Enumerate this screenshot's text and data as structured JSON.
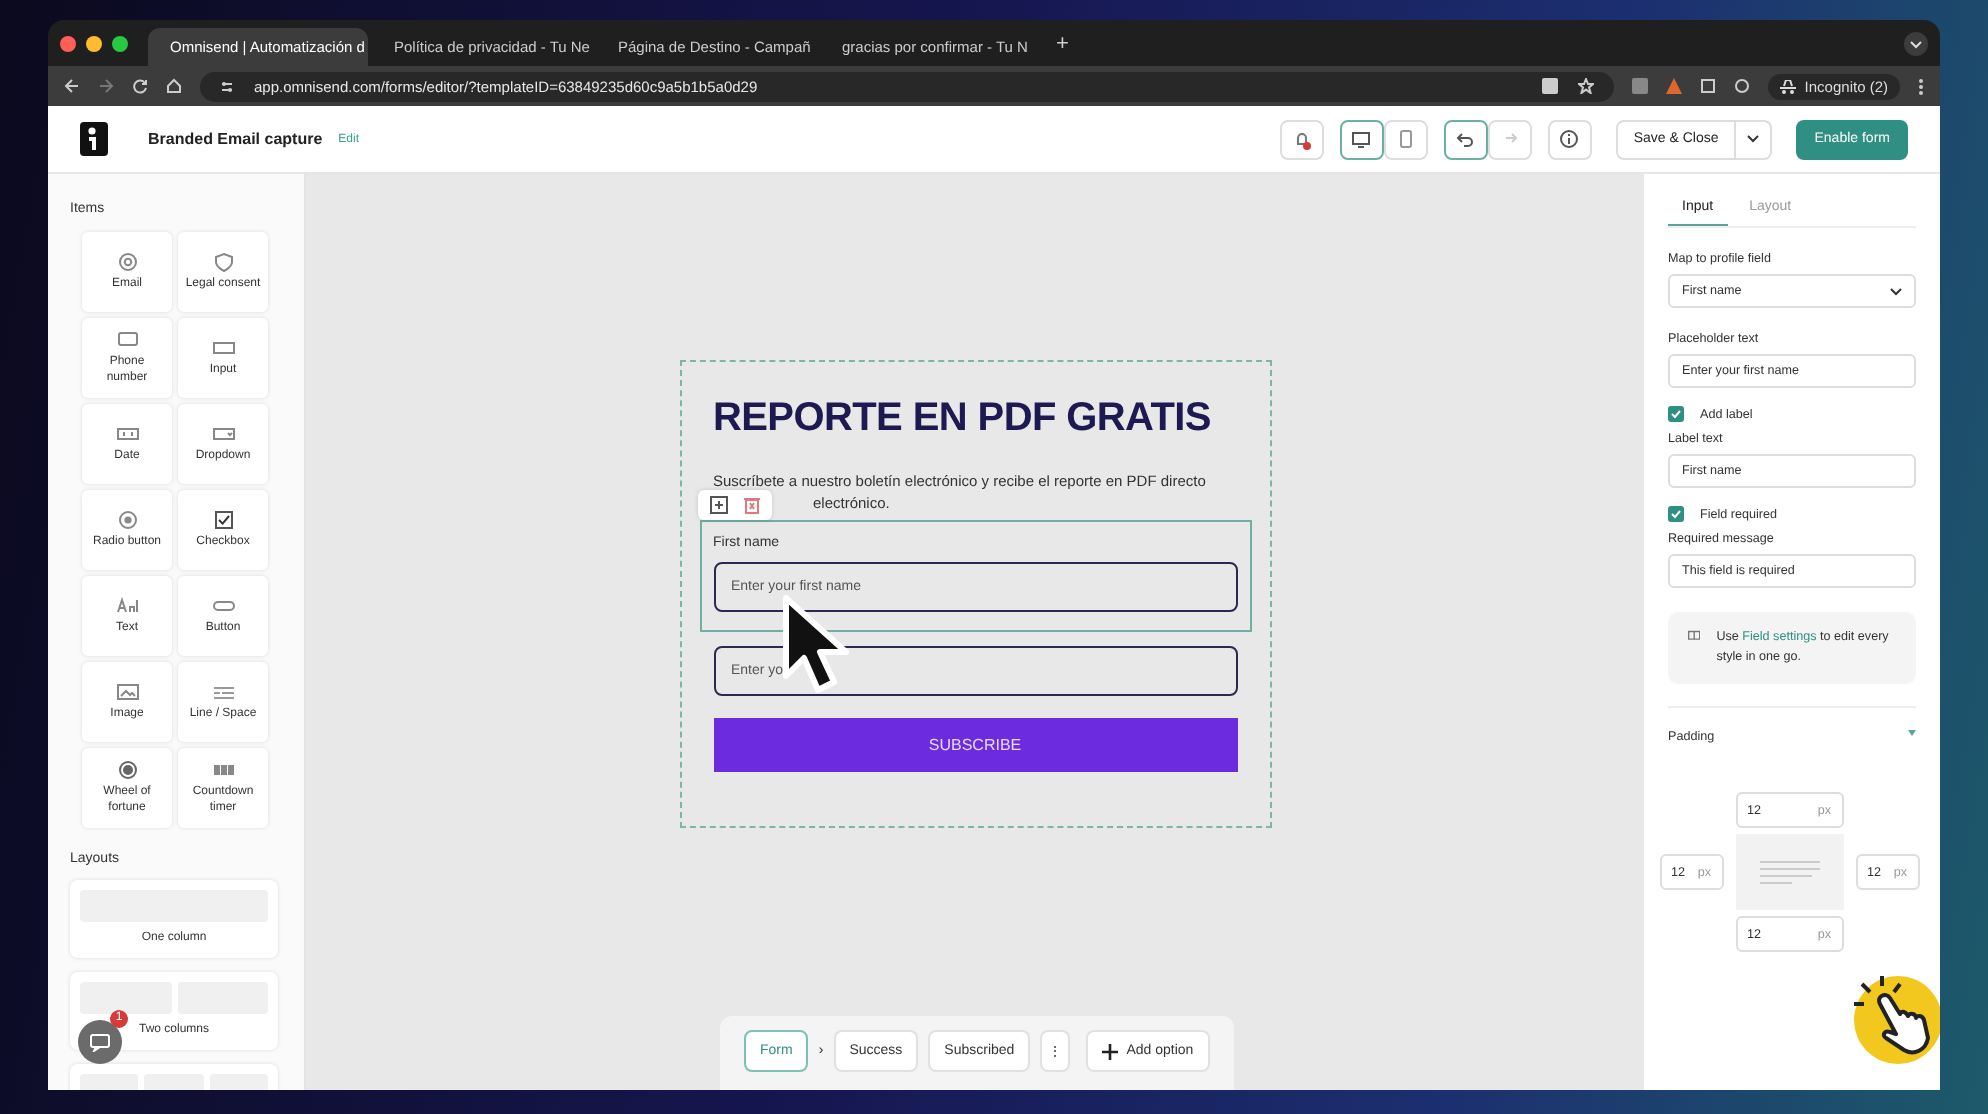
{
  "browser": {
    "tabs": [
      {
        "title": "Omnisend | Automatización d",
        "selected": true
      },
      {
        "title": "Política de privacidad - Tu Ne",
        "selected": false
      },
      {
        "title": "Página de Destino - Campañ",
        "selected": false
      },
      {
        "title": "gracias por confirmar - Tu N",
        "selected": false
      }
    ],
    "new_tab": "+",
    "url": "app.omnisend.com/forms/editor/?templateID=63849235d60c9a5b1b5a0d29",
    "profile": "Incognito (2)"
  },
  "header": {
    "title": "Branded Email capture",
    "edit": "Edit",
    "save": "Save & Close",
    "enable": "Enable form"
  },
  "sidebar": {
    "items_title": "Items",
    "items": [
      {
        "label": "Email",
        "kind": "email"
      },
      {
        "label": "Legal consent",
        "kind": "legal"
      },
      {
        "label": "Phone number",
        "kind": "phone"
      },
      {
        "label": "Input",
        "kind": "input"
      },
      {
        "label": "Date",
        "kind": "date"
      },
      {
        "label": "Dropdown",
        "kind": "dropdown"
      },
      {
        "label": "Radio button",
        "kind": "radio"
      },
      {
        "label": "Checkbox",
        "kind": "checkbox"
      },
      {
        "label": "Text",
        "kind": "text"
      },
      {
        "label": "Button",
        "kind": "button"
      },
      {
        "label": "Image",
        "kind": "image"
      },
      {
        "label": "Line / Space",
        "kind": "line"
      },
      {
        "label": "Wheel of fortune",
        "kind": "wheel"
      },
      {
        "label": "Countdown timer",
        "kind": "timer"
      }
    ],
    "layouts_title": "Layouts",
    "layouts": [
      {
        "label": "One column"
      },
      {
        "label": "Two columns"
      }
    ],
    "chat_badge": "1"
  },
  "form": {
    "heading": "REPORTE EN PDF GRATIS",
    "description_line": "Suscríbete a nuestro boletín electrónico y recibe el reporte en PDF directo",
    "description_tail": "electrónico.",
    "field_label": "First name",
    "fields": [
      {
        "placeholder": "Enter your first name",
        "selected": true
      },
      {
        "placeholder": "Enter yo",
        "selected": false
      }
    ],
    "button": "SUBSCRIBE"
  },
  "steps": [
    {
      "label": "Form",
      "selected": true
    },
    {
      "label": "Success",
      "selected": false
    },
    {
      "label": "Subscribed",
      "selected": false
    }
  ],
  "step_separator": "›",
  "more": "⋮",
  "add_option": "Add option",
  "panel": {
    "tabs": [
      {
        "label": "Input",
        "selected": true
      },
      {
        "label": "Layout",
        "selected": false
      }
    ],
    "map_label": "Map to profile field",
    "map_value": "First name",
    "placeholder_label": "Placeholder text",
    "placeholder_value": "Enter your first name",
    "add_label": {
      "label": "Add label",
      "checked": true
    },
    "label_text_label": "Label text",
    "label_text_value": "First name",
    "required": {
      "label": "Field required",
      "checked": true
    },
    "required_message_label": "Required message",
    "required_message_value": "This field is required",
    "info": "Use **Field settings** to edit every style in one go.",
    "padding_title": "Padding",
    "padding": [
      {
        "value": "12",
        "unit": "px"
      },
      {
        "value": "12",
        "unit": "px"
      },
      {
        "value": "12",
        "unit": "px"
      },
      {
        "value": "12",
        "unit": "px"
      }
    ]
  }
}
